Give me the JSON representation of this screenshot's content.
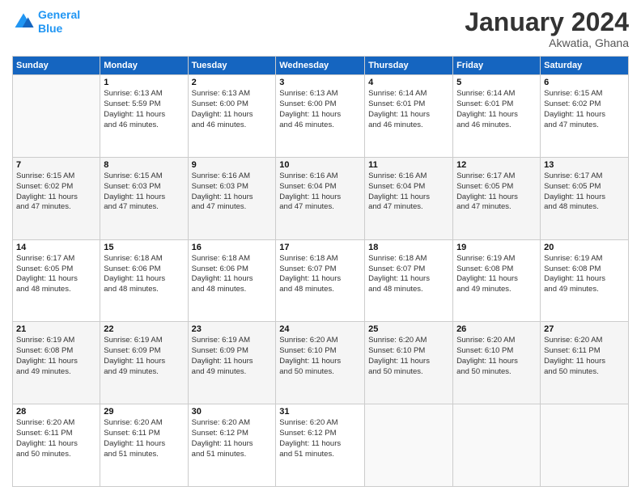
{
  "logo": {
    "line1": "General",
    "line2": "Blue"
  },
  "title": "January 2024",
  "location": "Akwatia, Ghana",
  "days_header": [
    "Sunday",
    "Monday",
    "Tuesday",
    "Wednesday",
    "Thursday",
    "Friday",
    "Saturday"
  ],
  "weeks": [
    [
      {
        "num": "",
        "info": ""
      },
      {
        "num": "1",
        "info": "Sunrise: 6:13 AM\nSunset: 5:59 PM\nDaylight: 11 hours\nand 46 minutes."
      },
      {
        "num": "2",
        "info": "Sunrise: 6:13 AM\nSunset: 6:00 PM\nDaylight: 11 hours\nand 46 minutes."
      },
      {
        "num": "3",
        "info": "Sunrise: 6:13 AM\nSunset: 6:00 PM\nDaylight: 11 hours\nand 46 minutes."
      },
      {
        "num": "4",
        "info": "Sunrise: 6:14 AM\nSunset: 6:01 PM\nDaylight: 11 hours\nand 46 minutes."
      },
      {
        "num": "5",
        "info": "Sunrise: 6:14 AM\nSunset: 6:01 PM\nDaylight: 11 hours\nand 46 minutes."
      },
      {
        "num": "6",
        "info": "Sunrise: 6:15 AM\nSunset: 6:02 PM\nDaylight: 11 hours\nand 47 minutes."
      }
    ],
    [
      {
        "num": "7",
        "info": "Sunrise: 6:15 AM\nSunset: 6:02 PM\nDaylight: 11 hours\nand 47 minutes."
      },
      {
        "num": "8",
        "info": "Sunrise: 6:15 AM\nSunset: 6:03 PM\nDaylight: 11 hours\nand 47 minutes."
      },
      {
        "num": "9",
        "info": "Sunrise: 6:16 AM\nSunset: 6:03 PM\nDaylight: 11 hours\nand 47 minutes."
      },
      {
        "num": "10",
        "info": "Sunrise: 6:16 AM\nSunset: 6:04 PM\nDaylight: 11 hours\nand 47 minutes."
      },
      {
        "num": "11",
        "info": "Sunrise: 6:16 AM\nSunset: 6:04 PM\nDaylight: 11 hours\nand 47 minutes."
      },
      {
        "num": "12",
        "info": "Sunrise: 6:17 AM\nSunset: 6:05 PM\nDaylight: 11 hours\nand 47 minutes."
      },
      {
        "num": "13",
        "info": "Sunrise: 6:17 AM\nSunset: 6:05 PM\nDaylight: 11 hours\nand 48 minutes."
      }
    ],
    [
      {
        "num": "14",
        "info": "Sunrise: 6:17 AM\nSunset: 6:05 PM\nDaylight: 11 hours\nand 48 minutes."
      },
      {
        "num": "15",
        "info": "Sunrise: 6:18 AM\nSunset: 6:06 PM\nDaylight: 11 hours\nand 48 minutes."
      },
      {
        "num": "16",
        "info": "Sunrise: 6:18 AM\nSunset: 6:06 PM\nDaylight: 11 hours\nand 48 minutes."
      },
      {
        "num": "17",
        "info": "Sunrise: 6:18 AM\nSunset: 6:07 PM\nDaylight: 11 hours\nand 48 minutes."
      },
      {
        "num": "18",
        "info": "Sunrise: 6:18 AM\nSunset: 6:07 PM\nDaylight: 11 hours\nand 48 minutes."
      },
      {
        "num": "19",
        "info": "Sunrise: 6:19 AM\nSunset: 6:08 PM\nDaylight: 11 hours\nand 49 minutes."
      },
      {
        "num": "20",
        "info": "Sunrise: 6:19 AM\nSunset: 6:08 PM\nDaylight: 11 hours\nand 49 minutes."
      }
    ],
    [
      {
        "num": "21",
        "info": "Sunrise: 6:19 AM\nSunset: 6:08 PM\nDaylight: 11 hours\nand 49 minutes."
      },
      {
        "num": "22",
        "info": "Sunrise: 6:19 AM\nSunset: 6:09 PM\nDaylight: 11 hours\nand 49 minutes."
      },
      {
        "num": "23",
        "info": "Sunrise: 6:19 AM\nSunset: 6:09 PM\nDaylight: 11 hours\nand 49 minutes."
      },
      {
        "num": "24",
        "info": "Sunrise: 6:20 AM\nSunset: 6:10 PM\nDaylight: 11 hours\nand 50 minutes."
      },
      {
        "num": "25",
        "info": "Sunrise: 6:20 AM\nSunset: 6:10 PM\nDaylight: 11 hours\nand 50 minutes."
      },
      {
        "num": "26",
        "info": "Sunrise: 6:20 AM\nSunset: 6:10 PM\nDaylight: 11 hours\nand 50 minutes."
      },
      {
        "num": "27",
        "info": "Sunrise: 6:20 AM\nSunset: 6:11 PM\nDaylight: 11 hours\nand 50 minutes."
      }
    ],
    [
      {
        "num": "28",
        "info": "Sunrise: 6:20 AM\nSunset: 6:11 PM\nDaylight: 11 hours\nand 50 minutes."
      },
      {
        "num": "29",
        "info": "Sunrise: 6:20 AM\nSunset: 6:11 PM\nDaylight: 11 hours\nand 51 minutes."
      },
      {
        "num": "30",
        "info": "Sunrise: 6:20 AM\nSunset: 6:12 PM\nDaylight: 11 hours\nand 51 minutes."
      },
      {
        "num": "31",
        "info": "Sunrise: 6:20 AM\nSunset: 6:12 PM\nDaylight: 11 hours\nand 51 minutes."
      },
      {
        "num": "",
        "info": ""
      },
      {
        "num": "",
        "info": ""
      },
      {
        "num": "",
        "info": ""
      }
    ]
  ]
}
